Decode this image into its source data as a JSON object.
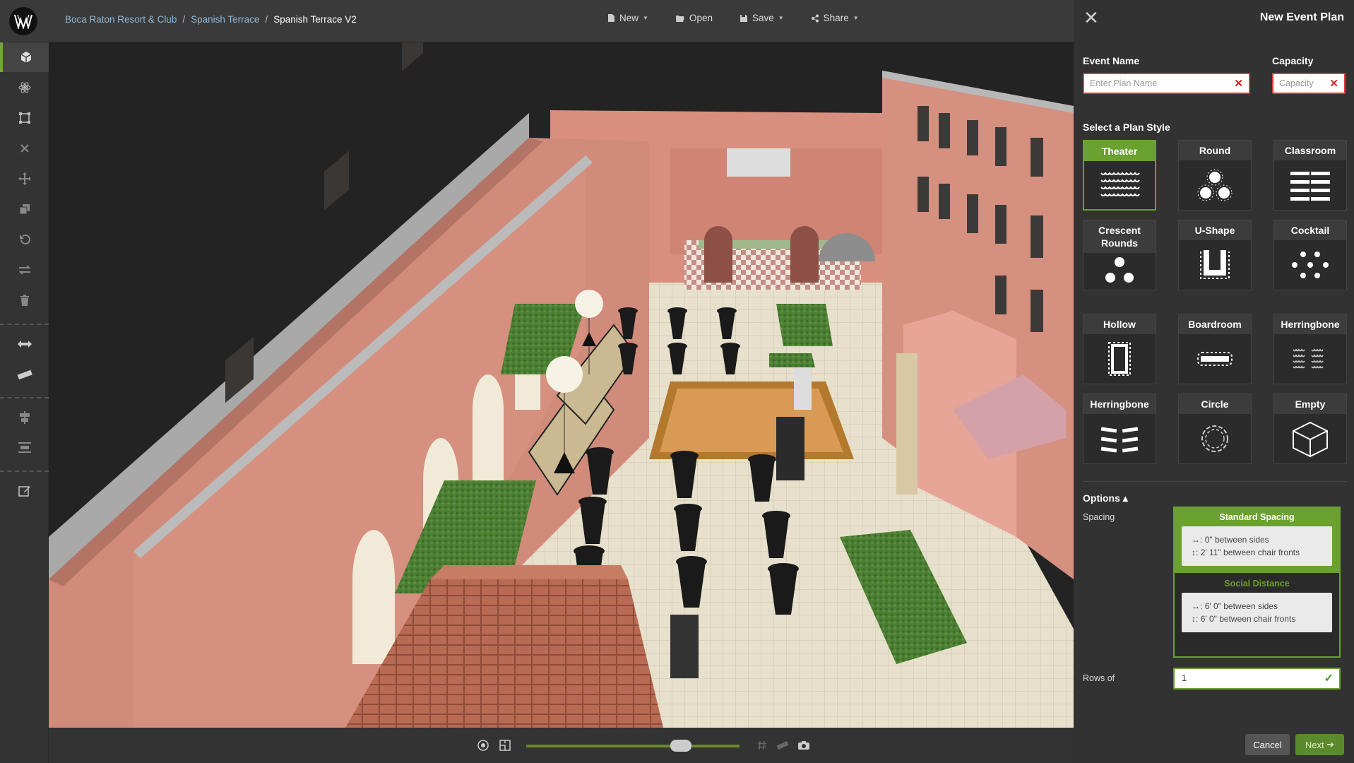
{
  "app": {
    "breadcrumb": [
      "Boca Raton Resort & Club",
      "Spanish Terrace",
      "Spanish Terrace V2"
    ],
    "menu": [
      {
        "label": "New",
        "icon": "file-icon"
      },
      {
        "label": "Open",
        "icon": "folder-open-icon"
      },
      {
        "label": "Save",
        "icon": "save-icon"
      },
      {
        "label": "Share",
        "icon": "share-icon"
      }
    ]
  },
  "left_tools": [
    "3d-view-icon",
    "atom-icon",
    "frame-icon",
    "close-icon",
    "move-icon",
    "copy-icon",
    "undo-icon",
    "swap-icon",
    "trash-icon",
    "width-icon",
    "ruler-icon",
    "align-center-icon",
    "distribute-icon",
    "edit-icon"
  ],
  "bottom_bar": {
    "icons": [
      "target-icon",
      "floorplan-icon",
      "hashtag-icon",
      "ruler-icon",
      "camera-icon"
    ],
    "zoom_level": 0.75
  },
  "panel": {
    "title": "New Event Plan",
    "event_name_label": "Event Name",
    "event_name_placeholder": "Enter Plan Name",
    "capacity_label": "Capacity",
    "capacity_placeholder": "Capacity",
    "plan_style_label": "Select a Plan Style",
    "styles": [
      {
        "label": "Theater",
        "selected": true
      },
      {
        "label": "Round"
      },
      {
        "label": "Classroom"
      },
      {
        "label": "Crescent Rounds"
      },
      {
        "label": "U-Shape"
      },
      {
        "label": "Cocktail"
      },
      {
        "label": "Hollow"
      },
      {
        "label": "Boardroom"
      },
      {
        "label": "Herringbone"
      },
      {
        "label": "Herringbone"
      },
      {
        "label": "Circle"
      },
      {
        "label": "Empty"
      }
    ],
    "options_label": "Options ▴",
    "spacing_label": "Spacing",
    "spacing": [
      {
        "title": "Standard Spacing",
        "sides": "0\" between sides",
        "fronts": "2' 11\" between chair fronts"
      },
      {
        "title": "Social Distance",
        "sides": "6' 0\" between sides",
        "fronts": "6' 0\" between chair fronts"
      }
    ],
    "rows_label": "Rows of",
    "rows_value": "1",
    "cancel_label": "Cancel",
    "next_label": "Next",
    "accent": "#6aa130"
  }
}
